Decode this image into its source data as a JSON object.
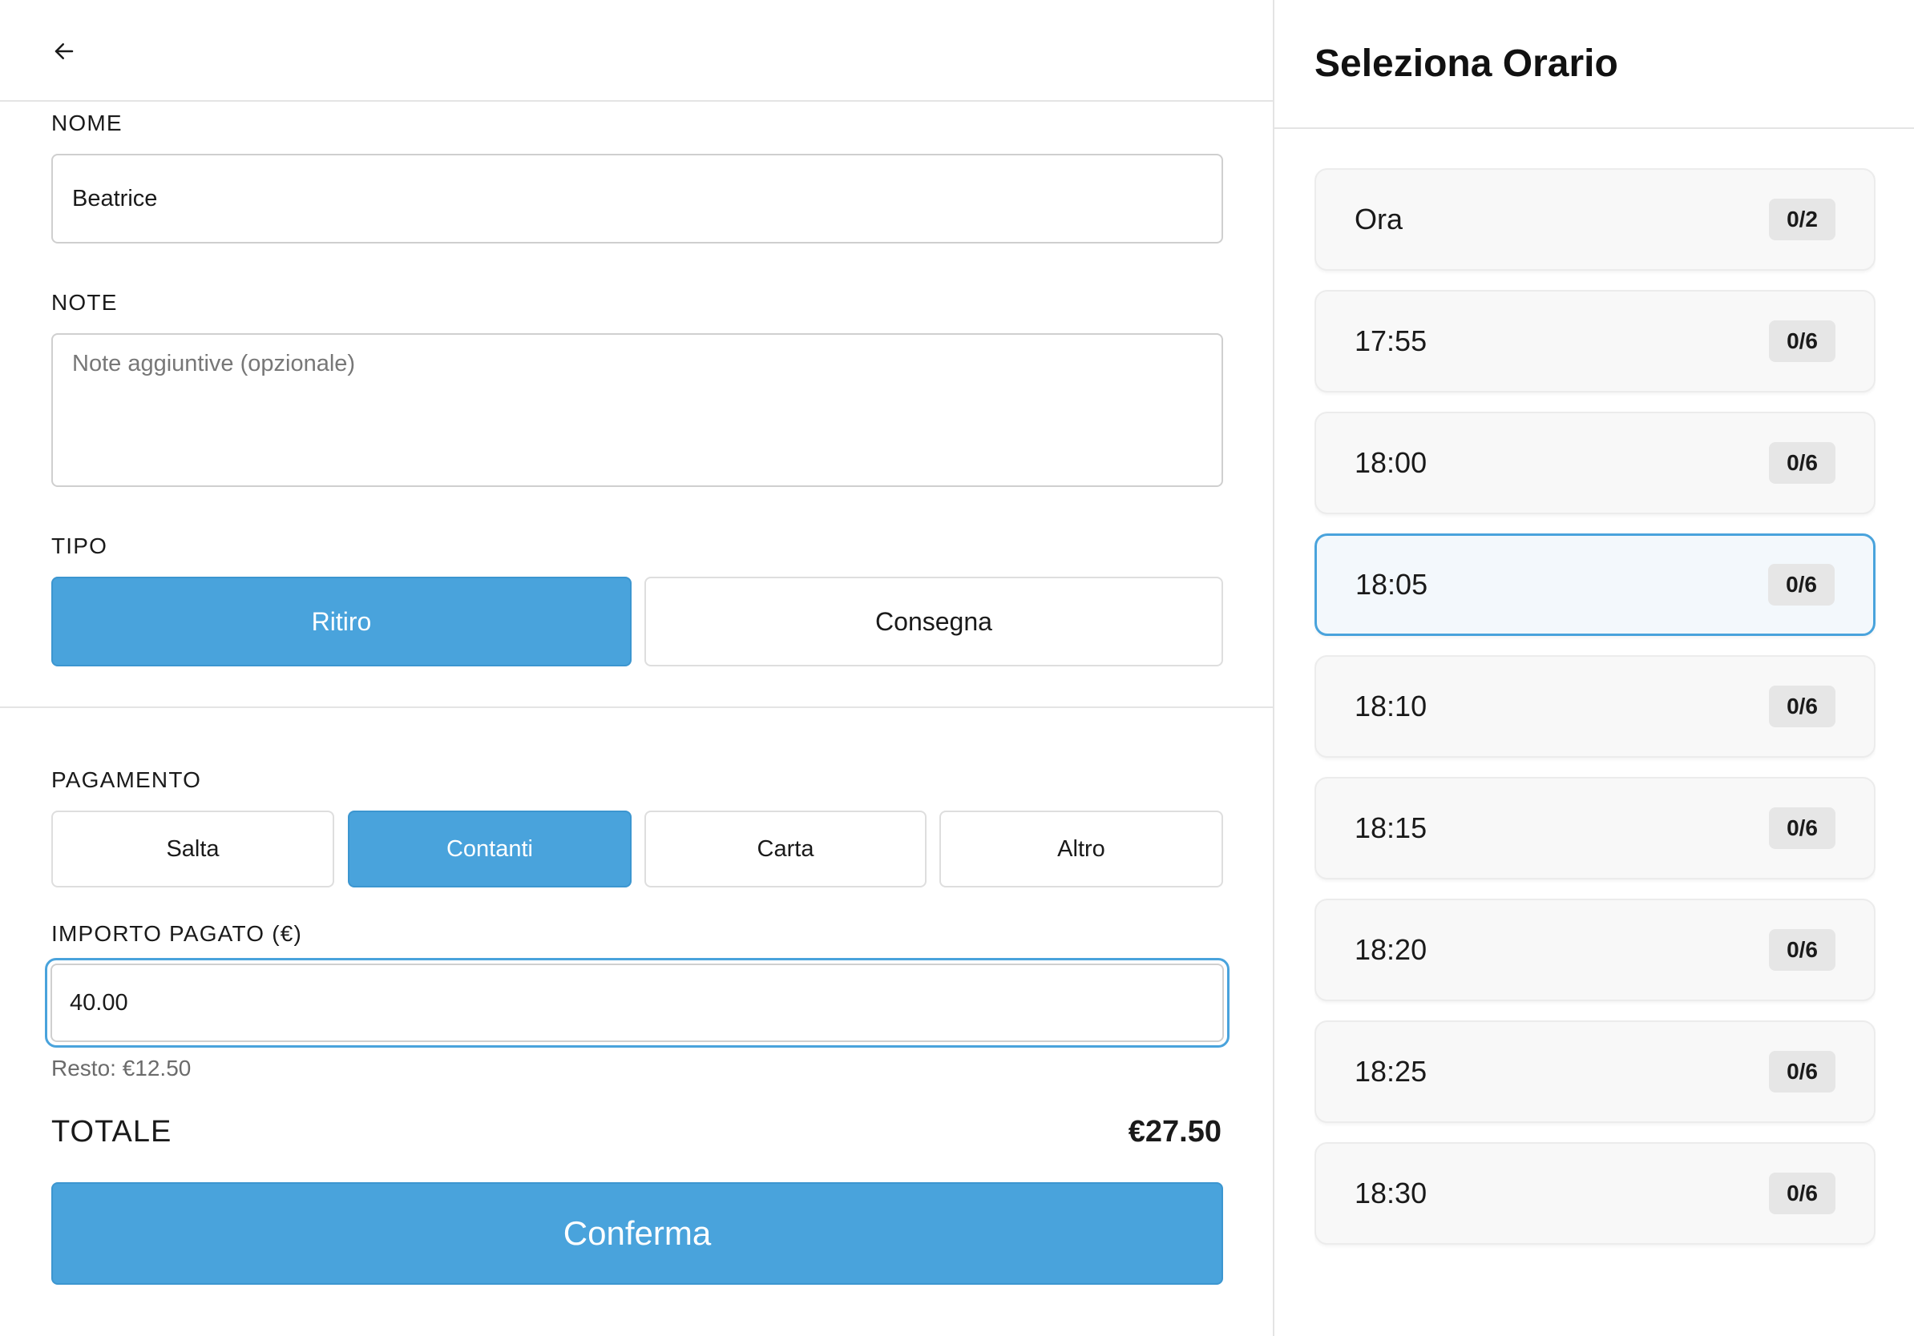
{
  "form": {
    "name_label": "NOME",
    "name_value": "Beatrice",
    "notes_label": "NOTE",
    "notes_placeholder": "Note aggiuntive (opzionale)",
    "type_label": "TIPO",
    "type_options": [
      "Ritiro",
      "Consegna"
    ],
    "type_selected": "Ritiro",
    "payment_label": "PAGAMENTO",
    "payment_options": [
      "Salta",
      "Contanti",
      "Carta",
      "Altro"
    ],
    "payment_selected": "Contanti",
    "amount_label": "IMPORTO PAGATO (€)",
    "amount_value": "40.00",
    "change_text": "Resto: €12.50",
    "total_label": "TOTALE",
    "total_value": "€27.50",
    "confirm_label": "Conferma"
  },
  "time_panel": {
    "title": "Seleziona Orario",
    "selected": "18:05",
    "slots": [
      {
        "time": "Ora",
        "count": "0/2"
      },
      {
        "time": "17:55",
        "count": "0/6"
      },
      {
        "time": "18:00",
        "count": "0/6"
      },
      {
        "time": "18:05",
        "count": "0/6"
      },
      {
        "time": "18:10",
        "count": "0/6"
      },
      {
        "time": "18:15",
        "count": "0/6"
      },
      {
        "time": "18:20",
        "count": "0/6"
      },
      {
        "time": "18:25",
        "count": "0/6"
      },
      {
        "time": "18:30",
        "count": "0/6"
      }
    ]
  },
  "colors": {
    "accent": "#49a3dc",
    "border": "#cfcfcf",
    "muted_text": "#6b6b6b"
  },
  "icons": {
    "back": "arrow-left-icon"
  }
}
